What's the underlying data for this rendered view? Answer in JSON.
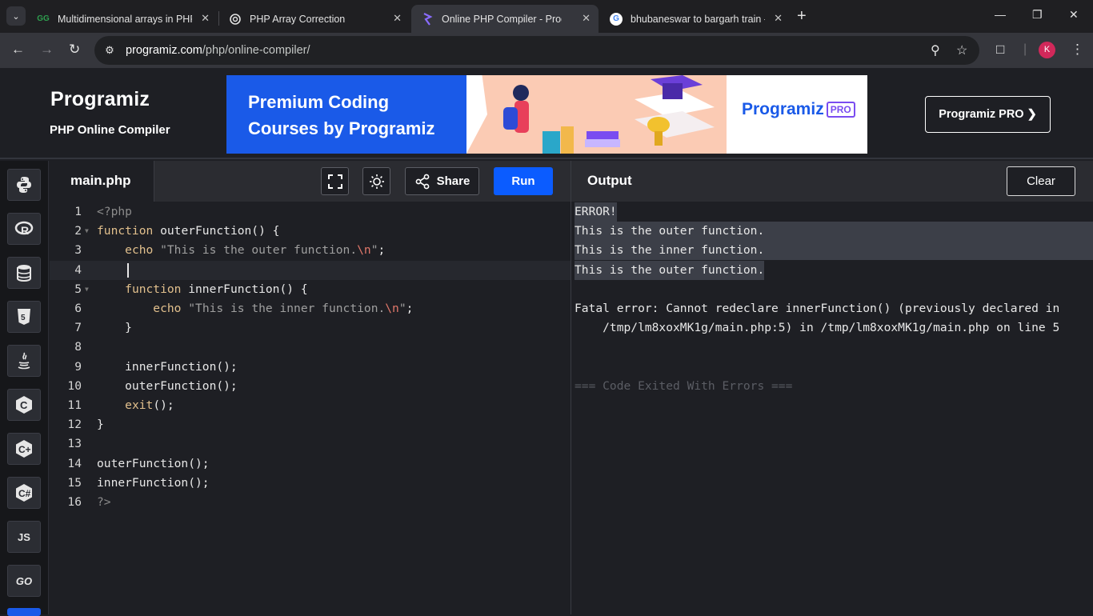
{
  "browser": {
    "tabs": [
      {
        "title": "Multidimensional arrays in PHP",
        "favicon": "GG"
      },
      {
        "title": "PHP Array Correction",
        "favicon": "chatgpt-icon"
      },
      {
        "title": "Online PHP Compiler - Programiz",
        "favicon": "programiz-icon"
      },
      {
        "title": "bhubaneswar to bargarh train -",
        "favicon": "G"
      }
    ],
    "url_domain": "programiz.com",
    "url_path": "/php/online-compiler/",
    "profile_initial": "K"
  },
  "header": {
    "logo": "Programiz",
    "subtitle": "PHP Online Compiler",
    "banner": {
      "line1": "Premium Coding",
      "line2": "Courses by Programiz",
      "brand": "Programiz",
      "badge": "PRO"
    },
    "pro_button": "Programiz PRO ❯"
  },
  "rail": {
    "languages": [
      "python-icon",
      "r-icon",
      "sql-icon",
      "html5-icon",
      "java-icon",
      "c-icon",
      "cpp-icon",
      "csharp-icon",
      "JS",
      "GO"
    ]
  },
  "editor": {
    "filename": "main.php",
    "share_label": "Share",
    "run_label": "Run"
  },
  "output": {
    "title": "Output",
    "clear_label": "Clear",
    "lines": [
      "ERROR!",
      "This is the outer function.",
      "This is the inner function.",
      "This is the outer function.",
      "",
      "Fatal error: Cannot redeclare innerFunction() (previously declared in",
      "    /tmp/lm8xoxMK1g/main.php:5) in /tmp/lm8xoxMK1g/main.php on line 5",
      "",
      "",
      "=== Code Exited With Errors ==="
    ]
  },
  "colors": {
    "run": "#0b5cff",
    "background": "#1e1f24",
    "keyword": "#e2c08d"
  }
}
